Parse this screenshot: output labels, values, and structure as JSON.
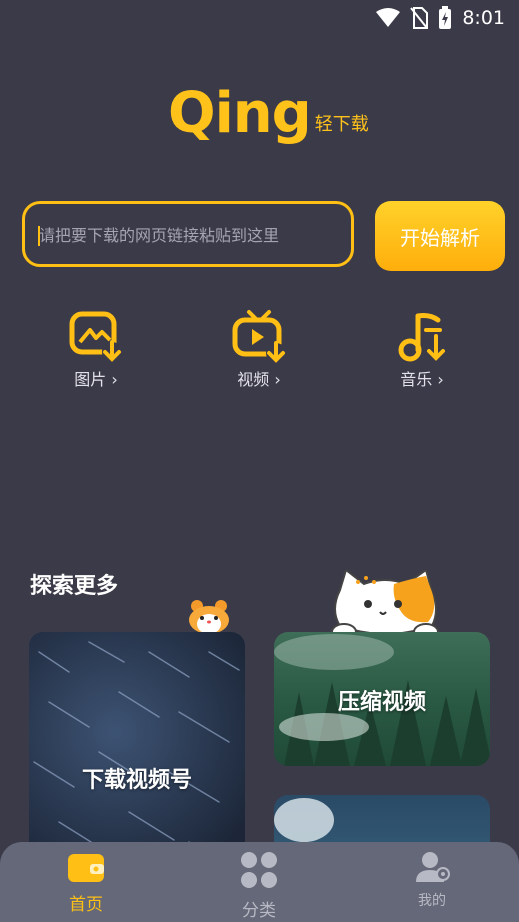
{
  "status_bar": {
    "time": "8:01"
  },
  "logo": {
    "main": "Qing",
    "sub": "轻下载"
  },
  "search": {
    "placeholder": "请把要下载的网页链接粘贴到这里",
    "button_label": "开始解析"
  },
  "quick_links": [
    {
      "label": "图片 ›",
      "icon": "image-download-icon"
    },
    {
      "label": "视频 ›",
      "icon": "video-download-icon"
    },
    {
      "label": "音乐 ›",
      "icon": "music-download-icon"
    }
  ],
  "explore": {
    "title": "探索更多",
    "cards": [
      {
        "label": "下载视频号"
      },
      {
        "label": "压缩视频"
      },
      {
        "label": ""
      }
    ]
  },
  "tabs": [
    {
      "label": "首页",
      "icon": "home-wallet-icon",
      "active": true
    },
    {
      "label": "分类",
      "icon": "grid-icon",
      "active": false
    },
    {
      "label": "我的",
      "icon": "user-icon",
      "active": false
    }
  ],
  "colors": {
    "accent": "#ffbf15",
    "background": "#3b3a48",
    "tabbar": "#656878"
  }
}
